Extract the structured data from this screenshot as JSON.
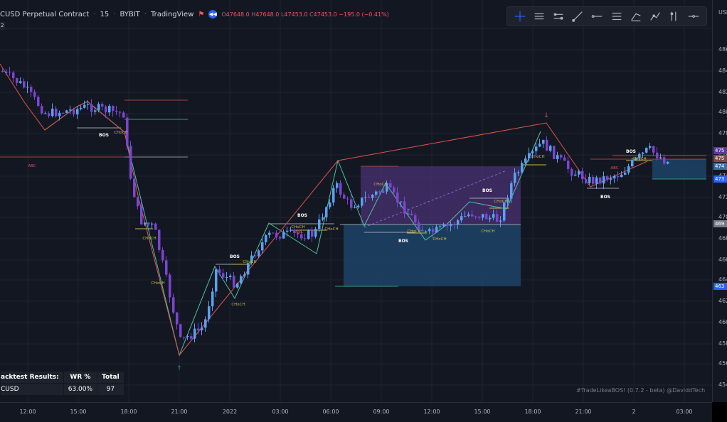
{
  "legend": {
    "symbol": "CUSD Perpetual Contract",
    "interval": "15",
    "exchange": "BYBIT",
    "source": "TradingView",
    "open_label": "O",
    "open": "47648.0",
    "high_label": "H",
    "high": "47648.0",
    "low_label": "L",
    "low": "47453.0",
    "close_label": "C",
    "close": "47453.0",
    "change": "−195.0 (−0.41%)",
    "sub_label": "2",
    "flag_icon": "flag-icon",
    "replay_icon": "rewind-icon"
  },
  "toolbar": {
    "tools": [
      {
        "name": "cross-line-icon"
      },
      {
        "name": "horizontal-lines-icon"
      },
      {
        "name": "parallel-channel-icon"
      },
      {
        "name": "trend-line-icon"
      },
      {
        "name": "horizontal-ray-icon"
      },
      {
        "name": "fib-lines-icon"
      },
      {
        "name": "brush-icon"
      },
      {
        "name": "path-icon"
      },
      {
        "name": "vertical-line-icon"
      },
      {
        "name": "dash-line-icon"
      }
    ]
  },
  "price_axis": {
    "currency": "USD",
    "ticks": [
      "486",
      "484",
      "482",
      "480",
      "478",
      "476",
      "474",
      "472",
      "470",
      "468",
      "466",
      "464",
      "462",
      "460",
      "458",
      "456",
      "454"
    ],
    "labels": [
      {
        "text": "475",
        "color": "#5b3a9e"
      },
      {
        "text": "475",
        "color": "#7c4b4b"
      },
      {
        "text": "474",
        "color": "#3a6ea5"
      },
      {
        "text": "473",
        "color": "#2962ff"
      },
      {
        "text": "469",
        "color": "#787b86"
      },
      {
        "text": "463",
        "color": "#2962ff"
      }
    ]
  },
  "time_axis": {
    "ticks": [
      "12:00",
      "15:00",
      "18:00",
      "21:00",
      "2022",
      "03:00",
      "06:00",
      "09:00",
      "12:00",
      "15:00",
      "18:00",
      "21:00",
      "2",
      "03:00"
    ]
  },
  "annotations": {
    "bos": "BOS",
    "choch": "CHoCH",
    "abc": "ABC",
    "down_arrow": "↓",
    "up_arrow": "↑"
  },
  "backtest": {
    "header": [
      "acktest Results:",
      "WR %",
      "Total"
    ],
    "row": [
      "CUSD",
      "63.00%",
      "97"
    ]
  },
  "watermark": "#TradeLikeaBOS! (0.7.2 - beta) @DaviddTech",
  "colors": {
    "background": "#131722",
    "up_candle": "#5aa0f0",
    "down_candle": "#7b45d1",
    "zigzag_red": "#e0544d",
    "zigzag_teal": "#4fc3a1",
    "choch": "#c9b84a",
    "accent": "#2962ff"
  }
}
